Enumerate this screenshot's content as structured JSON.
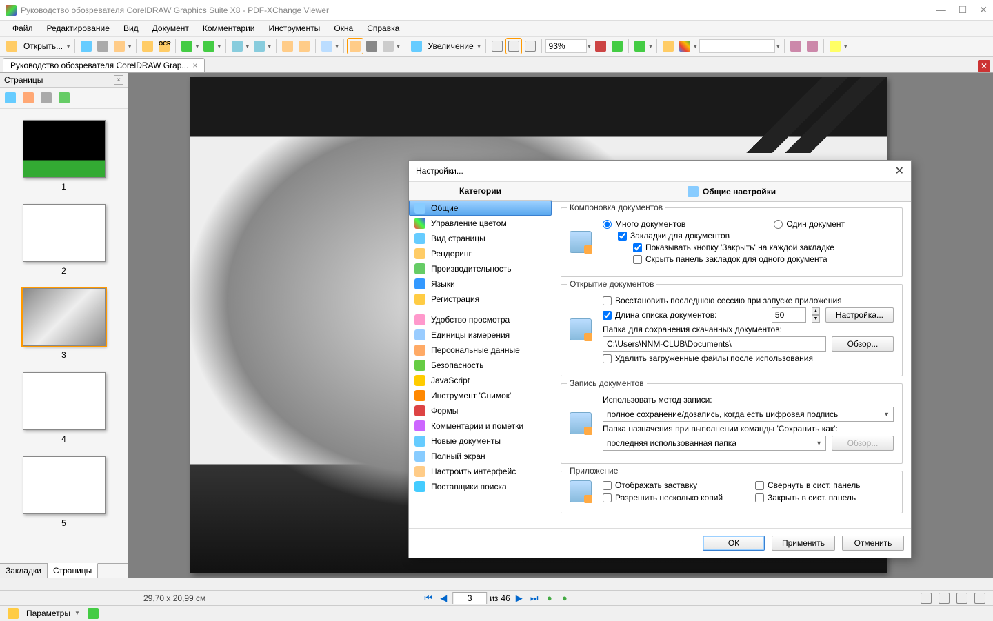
{
  "window": {
    "title": "Руководство обозревателя CorelDRAW Graphics Suite X8 - PDF-XChange Viewer"
  },
  "menu": {
    "items": [
      "Файл",
      "Редактирование",
      "Вид",
      "Документ",
      "Комментарии",
      "Инструменты",
      "Окна",
      "Справка"
    ]
  },
  "toolbar": {
    "open": "Открыть...",
    "zoom_label": "Увеличение",
    "zoom_value": "93%"
  },
  "doctab": {
    "title": "Руководство обозревателя CorelDRAW Grap..."
  },
  "sidebar": {
    "header": "Страницы",
    "tabs": {
      "bookmarks": "Закладки",
      "pages": "Страницы"
    },
    "thumbs": [
      {
        "num": "1"
      },
      {
        "num": "2"
      },
      {
        "num": "3"
      },
      {
        "num": "4"
      },
      {
        "num": "5"
      }
    ],
    "selected": 2
  },
  "status": {
    "pos": "29,70 x 20,99 см",
    "page_current": "3",
    "page_sep": "из",
    "page_total": "46"
  },
  "bottombar": {
    "params": "Параметры"
  },
  "dialog": {
    "title": "Настройки...",
    "cats_header": "Категории",
    "right_header": "Общие настройки",
    "categories": [
      "Общие",
      "Управление цветом",
      "Вид страницы",
      "Рендеринг",
      "Производительность",
      "Языки",
      "Регистрация",
      "Удобство просмотра",
      "Единицы измерения",
      "Персональные данные",
      "Безопасность",
      "JavaScript",
      "Инструмент 'Снимок'",
      "Формы",
      "Комментарии и пометки",
      "Новые документы",
      "Полный экран",
      "Настроить интерфейс",
      "Поставщики поиска"
    ],
    "selected_cat": 0,
    "grp_layout": {
      "legend": "Компоновка документов",
      "multi": "Много документов",
      "single": "Один документ",
      "tabs": "Закладки для документов",
      "showclose": "Показывать кнопку 'Закрыть' на каждой закладке",
      "hidebar": "Скрыть панель закладок для одного документа"
    },
    "grp_open": {
      "legend": "Открытие документов",
      "restore": "Восстановить последнюю сессию при запуске приложения",
      "listlen": "Длина списка документов:",
      "listlen_val": "50",
      "config_btn": "Настройка...",
      "save_folder_label": "Папка для сохранения скачанных документов:",
      "save_folder_val": "C:\\Users\\NNM-CLUB\\Documents\\",
      "browse": "Обзор...",
      "delete_after": "Удалить загруженные файлы после использования"
    },
    "grp_save": {
      "legend": "Запись документов",
      "method_label": "Использовать метод записи:",
      "method_val": "полное сохранение/дозапись, когда есть цифровая подпись",
      "saveas_label": "Папка назначения при выполнении команды 'Сохранить как':",
      "saveas_val": "последняя использованная папка",
      "browse": "Обзор..."
    },
    "grp_app": {
      "legend": "Приложение",
      "splash": "Отображать заставку",
      "multi_inst": "Разрешить несколько копий",
      "min_tray": "Свернуть в сист. панель",
      "close_tray": "Закрыть в сист. панель"
    },
    "buttons": {
      "ok": "ОК",
      "apply": "Применить",
      "cancel": "Отменить"
    }
  }
}
